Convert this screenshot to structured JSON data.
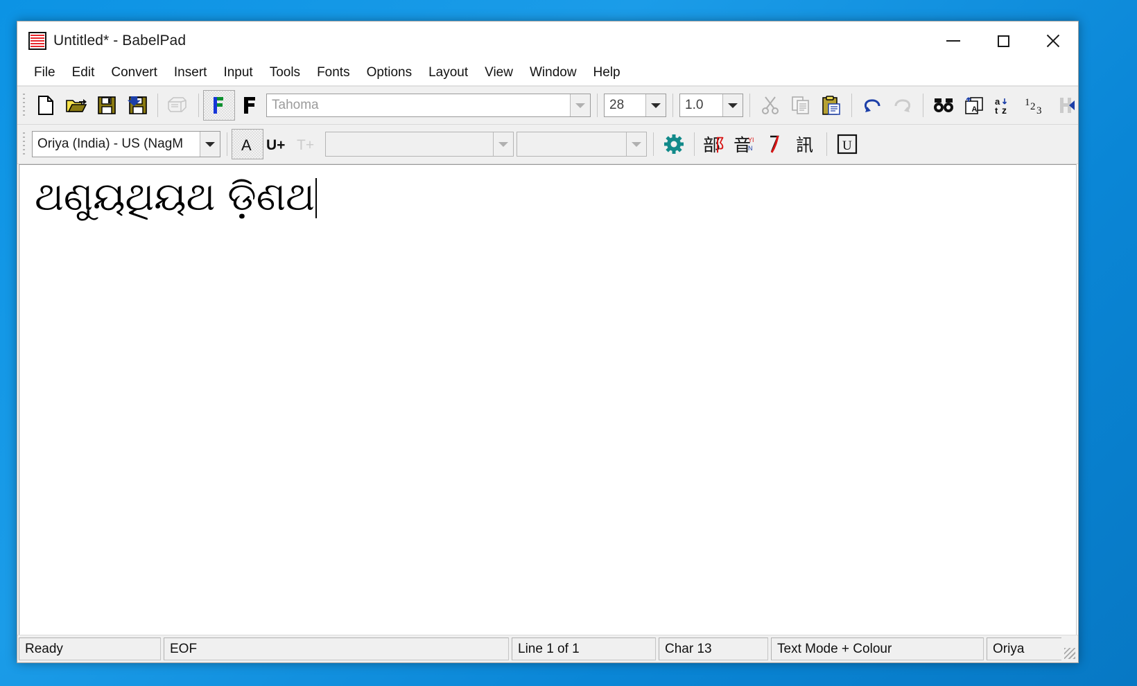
{
  "window": {
    "title": "Untitled* - BabelPad",
    "icon": "babelpad-icon",
    "controls": {
      "minimize": "—",
      "maximize": "□",
      "close": "✕"
    }
  },
  "menubar": {
    "items": [
      {
        "label": "File"
      },
      {
        "label": "Edit"
      },
      {
        "label": "Convert"
      },
      {
        "label": "Insert"
      },
      {
        "label": "Input"
      },
      {
        "label": "Tools"
      },
      {
        "label": "Fonts"
      },
      {
        "label": "Options"
      },
      {
        "label": "Layout"
      },
      {
        "label": "View"
      },
      {
        "label": "Window"
      },
      {
        "label": "Help"
      }
    ]
  },
  "toolbar_main": {
    "buttons": [
      {
        "name": "new-file-icon",
        "label": "New",
        "enabled": true
      },
      {
        "name": "open-file-icon",
        "label": "Open",
        "enabled": true
      },
      {
        "name": "save-icon",
        "label": "Save",
        "enabled": true
      },
      {
        "name": "save-as-icon",
        "label": "Save As",
        "enabled": true
      },
      {
        "name": "print-icon",
        "label": "Print",
        "enabled": false
      },
      {
        "name": "font-colour-icon",
        "label": "Font Colour",
        "enabled": true
      },
      {
        "name": "font-bold-icon",
        "label": "Font",
        "enabled": true
      }
    ],
    "font_name": "Tahoma",
    "font_size": "28",
    "line_spacing": "1.0",
    "edit_buttons": [
      {
        "name": "cut-icon",
        "label": "Cut",
        "enabled": false
      },
      {
        "name": "copy-icon",
        "label": "Copy",
        "enabled": false
      },
      {
        "name": "paste-icon",
        "label": "Paste",
        "enabled": true
      }
    ],
    "history_buttons": [
      {
        "name": "undo-icon",
        "label": "Undo",
        "enabled": true
      },
      {
        "name": "redo-icon",
        "label": "Redo",
        "enabled": false
      }
    ],
    "tool_buttons": [
      {
        "name": "find-icon",
        "label": "Find",
        "enabled": true
      },
      {
        "name": "find-replace-icon",
        "label": "Find and Replace",
        "enabled": true
      },
      {
        "name": "sort-alpha-icon",
        "label": "Sort a-z",
        "enabled": true
      },
      {
        "name": "sort-numeric-icon",
        "label": "Sort 1-2-3",
        "enabled": true
      },
      {
        "name": "hex-mode-icon",
        "label": "H",
        "enabled": false
      }
    ],
    "overflow": {
      "name": "toolbar-overflow-icon",
      "label": "◀"
    }
  },
  "toolbar_input": {
    "keyboard_layout": "Oriya (India) - US (NagM",
    "buttons": [
      {
        "name": "char-input-icon",
        "label": "A",
        "enabled": true
      },
      {
        "name": "unicode-input-icon",
        "label": "U+",
        "enabled": true
      },
      {
        "name": "text-input-icon",
        "label": "T+",
        "enabled": false
      }
    ],
    "combo_block": "",
    "combo_char": "",
    "settings_button": {
      "name": "gear-icon",
      "label": "Settings"
    },
    "ime_buttons": [
      {
        "name": "radical-input-icon",
        "label": "部"
      },
      {
        "name": "pinyin-input-icon",
        "label": "音"
      },
      {
        "name": "stroke-input-icon",
        "label": "丿"
      },
      {
        "name": "cangjie-input-icon",
        "label": "訊"
      }
    ],
    "unicode_button": {
      "name": "unicode-mode-icon",
      "label": "U"
    }
  },
  "editor": {
    "text": "ଥଣୁୟଥିୟଥ ଡ଼ିଣଥ",
    "caret_visible": true
  },
  "statusbar": {
    "ready": "Ready",
    "eof": "EOF",
    "line": "Line 1 of 1",
    "char": "Char 13",
    "mode": "Text Mode + Colour",
    "language": "Oriya"
  },
  "colors": {
    "desktop": "#0c93e4",
    "titlebar": "#ffffff",
    "toolbar": "#f0f0f0",
    "accent_red": "#e8252a",
    "accent_blue": "#1c3fa8",
    "accent_teal": "#128a8a",
    "gold": "#8a7a12"
  }
}
